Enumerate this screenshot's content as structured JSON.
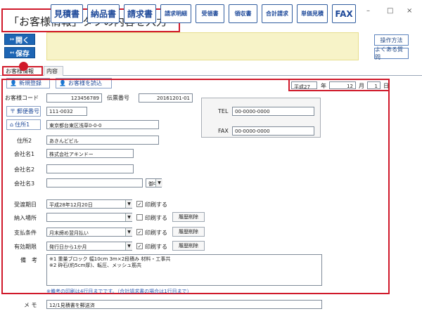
{
  "window": {
    "controls": [
      "–",
      "□",
      "×"
    ]
  },
  "callout": {
    "text": "「お客様情報」タブの内容を入力"
  },
  "side": {
    "open_label": "開く",
    "save_label": "保存"
  },
  "toolbar": {
    "quote": "見積書",
    "delivery": "納品書",
    "invoice": "請求書",
    "invoice_detail": "請求明細",
    "receipt": "受領書",
    "receipt2": "領収書",
    "total_invoice": "合計請求",
    "unit_quote": "単価見積",
    "fax": "FAX",
    "help": "操作方法",
    "faq": "よくある質問"
  },
  "tabs": {
    "customer": "お客様情報",
    "content": "内容"
  },
  "actions": {
    "new_register": "新規登録",
    "load_customer": "お客様を読込"
  },
  "date": {
    "era": "平成27",
    "year_label": "年",
    "month": "12",
    "month_label": "月",
    "day": "1",
    "day_label": "日"
  },
  "form": {
    "customer_code_label": "お客様コード",
    "customer_code": "123456789",
    "slip_label": "伝票番号",
    "slip_number": "20161201-01",
    "postal_label": "郵便番号",
    "postal_code": "111-0032",
    "address1_label": "住所1",
    "address1": "東京都台東区浅草0-0-0",
    "address2_label": "住所2",
    "address2": "あきんどビル",
    "company1_label": "会社名1",
    "company1": "株式会社アキンドー",
    "company2_label": "会社名2",
    "company2": "",
    "company3_label": "会社名3",
    "company3": "",
    "honorific": "御中",
    "tel_label": "TEL",
    "tel": "00-0000-0000",
    "fax_label": "FAX",
    "fax": "00-0000-0000"
  },
  "terms": {
    "delivery_deadline_label": "受渡期日",
    "delivery_deadline": "平成28年12月20日",
    "delivery_place_label": "納入場所",
    "delivery_place": "",
    "payment_label": "支払条件",
    "payment": "月末締め翌月払い",
    "validity_label": "有効期限",
    "validity": "発行日から1か月",
    "print_label": "印刷する",
    "history_delete": "履歴削除",
    "notes_label": "備　考",
    "notes_line1": "※1 重量ブロック 幅10cm 3m×2段積み 材料・工事共",
    "notes_line2": "※2 砕石(約5cm厚)、転圧、メッシュ筋共",
    "notes_hint": "※備考の印刷は4行目までです。（合計請求書の場合は1行目まで）"
  },
  "memo": {
    "label": "メ モ",
    "value": "12/1見積書を郵送済"
  }
}
